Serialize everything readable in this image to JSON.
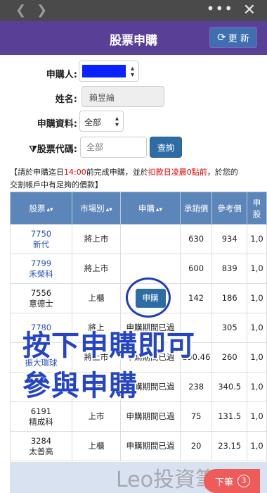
{
  "browser": {
    "back_icon": "chevron-left-icon",
    "forward_icon": "chevron-right-icon",
    "more_label": "•••",
    "close_label": "✕"
  },
  "header": {
    "title": "股票申購",
    "refresh_label": "更 新",
    "refresh_icon": "⟳"
  },
  "form": {
    "applicant_label": "申購人:",
    "name_label": "姓名:",
    "name_value": "賴昱綸",
    "data_label": "申購資料:",
    "data_value": "全部",
    "code_label": "股票代碼:",
    "code_placeholder": "全部",
    "query_label": "查詢"
  },
  "notice": {
    "part1": "【請於申購迄日",
    "time": "14:00",
    "part2": "前完成申購，並於",
    "deduct": "扣款日凌晨0點前",
    "part3": "，於您的",
    "line2": "交割帳戶中有足夠的價款】"
  },
  "table": {
    "headers": [
      "股票",
      "市場別",
      "申購",
      "承銷價",
      "參考價",
      "申",
      "股"
    ],
    "rows": [
      {
        "code": "7750",
        "name": "新代",
        "market": "將上市",
        "action": "",
        "price": "630",
        "ref": "934",
        "extra": "1,0",
        "blue": true
      },
      {
        "code": "7799",
        "name": "禾榮科",
        "market": "將上市",
        "action": "",
        "price": "600",
        "ref": "839",
        "extra": "1,0",
        "blue": true
      },
      {
        "code": "7556",
        "name": "意德士",
        "market": "上櫃",
        "action": "申購",
        "price": "142",
        "ref": "186",
        "extra": "1,0",
        "blue": false
      },
      {
        "code": "7780",
        "name": "",
        "market": "將上",
        "action": "申購期間已過",
        "price": "",
        "ref": "305",
        "extra": "1,0",
        "blue": true
      },
      {
        "code": "",
        "name": "振大環球",
        "market": "將上市",
        "action": "申購期間已過",
        "price": "190.46",
        "ref": "260",
        "extra": "1,0",
        "blue": true
      },
      {
        "code": "",
        "name": "",
        "market": "上櫃",
        "action": "申購期間已過",
        "price": "238",
        "ref": "340.5",
        "extra": "1,0",
        "blue": true
      },
      {
        "code": "6191",
        "name": "精成科",
        "market": "上市",
        "action": "申購期間已過",
        "price": "75",
        "ref": "131.5",
        "extra": "1,0",
        "blue": false
      },
      {
        "code": "3284",
        "name": "太普高",
        "market": "上櫃",
        "action": "申購期間已過",
        "price": "20",
        "ref": "23.15",
        "extra": "1,0",
        "blue": false
      }
    ]
  },
  "overlay": {
    "line1": "按下申購即可",
    "line2": "參與申購"
  },
  "watermark": "Leo投資筆記",
  "next": {
    "label": "下筆",
    "badge": "3"
  },
  "colors": {
    "header_bg": "#5a3f96",
    "table_header_bg": "#5c86b9",
    "button_blue": "#2e6da4",
    "alert_red": "#e60000",
    "overlay_blue": "#2545c4"
  }
}
